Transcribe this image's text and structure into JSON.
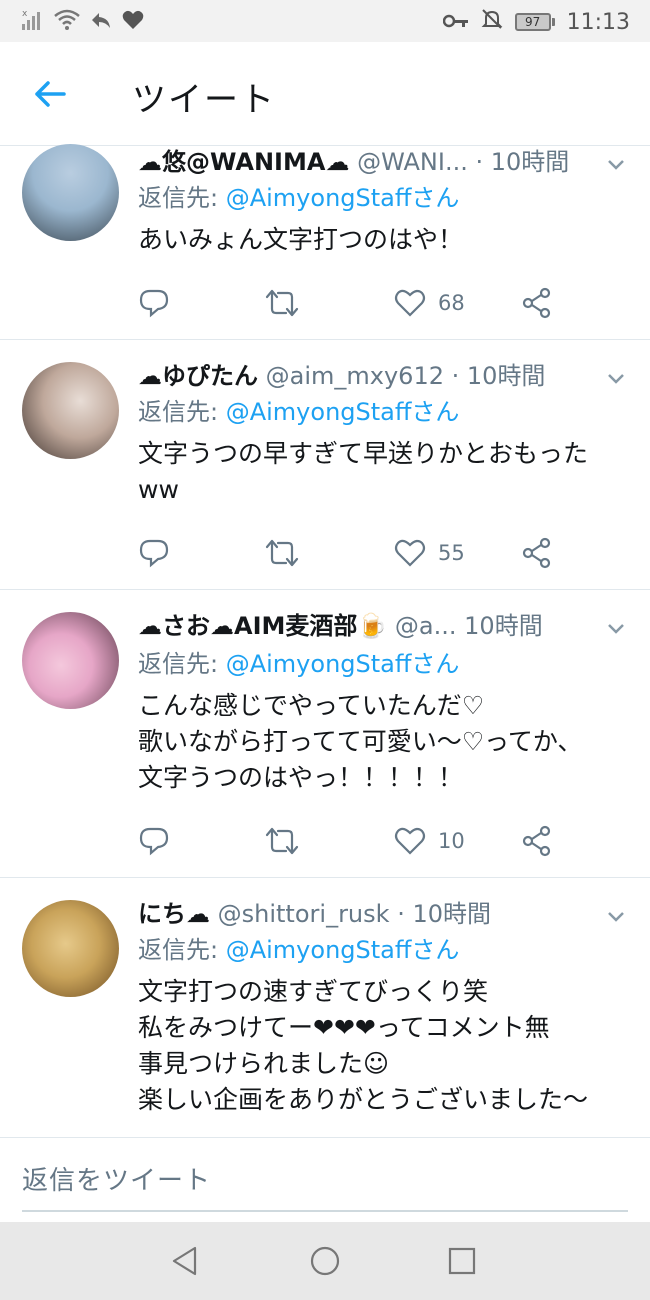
{
  "status_bar": {
    "battery": "97",
    "time": "11:13"
  },
  "header": {
    "title": "ツイート"
  },
  "tweets": [
    {
      "name": "☁悠@WANIMA☁",
      "handle": "@WANI...",
      "time": "· 10時間",
      "reply_prefix": "返信先: ",
      "reply_to": "@AimyongStaffさん",
      "text": "あいみょん文字打つのはや！",
      "like_count": "68",
      "avatar_colors": [
        "#9bb7cf",
        "#3d4a55"
      ]
    },
    {
      "name": "☁ゆぴたん",
      "handle": "@aim_mxy612",
      "time": "· 10時間",
      "reply_prefix": "返信先: ",
      "reply_to": "@AimyongStaffさん",
      "text": "文字うつの早すぎて早送りかとおもった\nww",
      "like_count": "55",
      "avatar_colors": [
        "#d8c9c0",
        "#3b302c"
      ]
    },
    {
      "name": "☁さお☁AIM麦酒部🍺",
      "handle": "@a...",
      "time": "10時間",
      "reply_prefix": "返信先: ",
      "reply_to": "@AimyongStaffさん",
      "text": "こんな感じでやっていたんだ♡\n歌いながら打ってて可愛い〜♡ってか、\n文字うつのはやっ！！！！！",
      "like_count": "10",
      "avatar_colors": [
        "#e6a6c7",
        "#5b3a4a"
      ]
    },
    {
      "name": "にち☁",
      "handle": "@shittori_rusk",
      "time": "· 10時間",
      "reply_prefix": "返信先: ",
      "reply_to": "@AimyongStaffさん",
      "text": "文字打つの速すぎてびっくり笑\n私をみつけてー❤❤❤ってコメント無\n事見つけられました☺\n楽しい企画をありがとうございました〜",
      "like_count": "",
      "avatar_colors": [
        "#c9a35a",
        "#6b4a20"
      ]
    }
  ],
  "composer": {
    "placeholder": "返信をツイート"
  },
  "colors": {
    "accent": "#1da1f2",
    "secondary_text": "#657786",
    "heart": "#e0245e"
  },
  "icons": [
    "signal-icon",
    "wifi-icon",
    "reply-status-icon",
    "heart-status-icon",
    "key-icon",
    "mute-bell-icon",
    "battery-icon",
    "back-arrow-icon",
    "reply-icon",
    "retweet-icon",
    "like-icon",
    "share-icon",
    "caret-down-icon",
    "nav-back-icon",
    "nav-home-icon",
    "nav-recents-icon"
  ]
}
